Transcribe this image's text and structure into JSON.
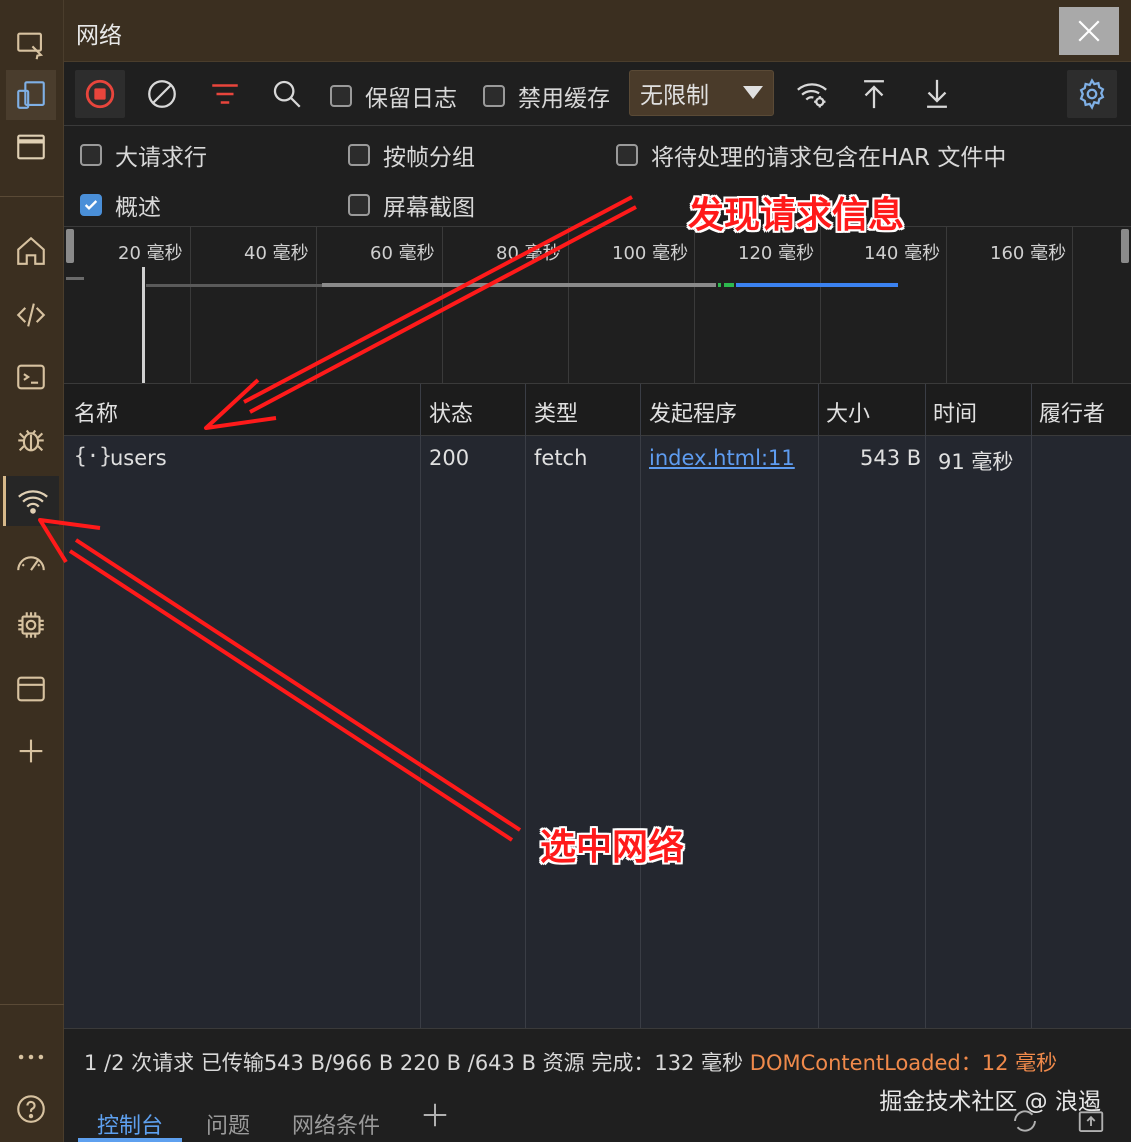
{
  "window": {
    "title": "网络"
  },
  "toolbar": {
    "preserve_log_label": "保留日志",
    "disable_cache_label": "禁用缓存",
    "throttling_value": "无限制"
  },
  "options": {
    "big_rows_label": "大请求行",
    "group_by_frame_label": "按帧分组",
    "har_label": "将待处理的请求包含在HAR 文件中",
    "overview_label": "概述",
    "screenshots_label": "屏幕截图"
  },
  "timeline": {
    "ticks": [
      "20 毫秒",
      "40 毫秒",
      "60 毫秒",
      "80 毫秒",
      "100 毫秒",
      "120 毫秒",
      "140 毫秒",
      "160 毫秒"
    ]
  },
  "table": {
    "headers": {
      "name": "名称",
      "status": "状态",
      "type": "类型",
      "initiator": "发起程序",
      "size": "大小",
      "time": "时间",
      "fulfilled_by": "履行者"
    },
    "rows": [
      {
        "name": "users",
        "status": "200",
        "type": "fetch",
        "initiator": "index.html:11",
        "size": "543 B",
        "time": "91 毫秒"
      }
    ]
  },
  "status_bar": {
    "summary": "1 /2 次请求 已传输543 B/966 B 220 B /643 B 资源 完成：132 毫秒",
    "dom_content_loaded": "DOMContentLoaded：12 毫秒"
  },
  "drawer": {
    "tabs": [
      "控制台",
      "问题",
      "网络条件"
    ],
    "watermark": "掘金技术社区 @ 浪遏"
  },
  "annotations": {
    "discover_request": "发现请求信息",
    "select_network": "选中网络"
  },
  "colors": {
    "annotation": "#ff1a1a",
    "accent": "#5ea0ef",
    "record": "#e8453c",
    "filter": "#e8453c"
  }
}
